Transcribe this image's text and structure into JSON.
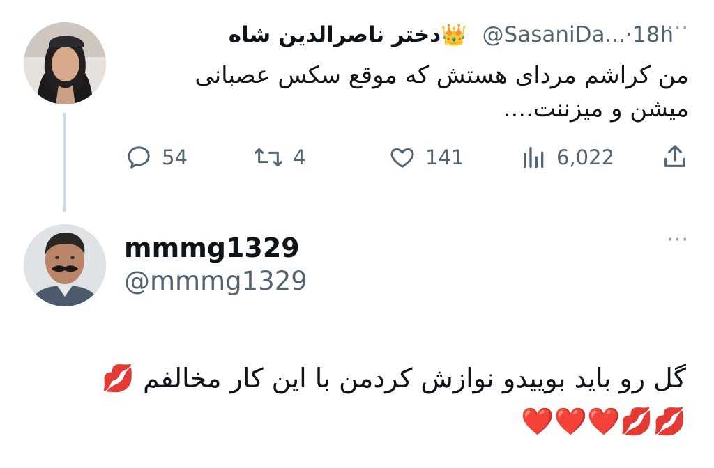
{
  "tweet1": {
    "display_name": "دختر ناصرالدین شاه",
    "name_emoji": "👑",
    "handle": "@SasaniDa...",
    "separator": "·",
    "time": "18h",
    "more_label": "···",
    "text": "من کراشم مردای هستش که موقع سکس عصبانی\nمیشن و میزننت....",
    "actions": {
      "replies": "54",
      "retweets": "4",
      "likes": "141",
      "views": "6,022"
    }
  },
  "tweet2": {
    "display_name": "mmmg1329",
    "handle": "@mmmg1329",
    "more_label": "···",
    "text": "گل رو باید بوییدو نوازش کردمن با این کار مخالفم 💋\n💋💋❤️❤️❤️"
  },
  "colors": {
    "text_primary": "#0f1419",
    "text_secondary": "#536471",
    "thread_line": "#cfd9de"
  }
}
